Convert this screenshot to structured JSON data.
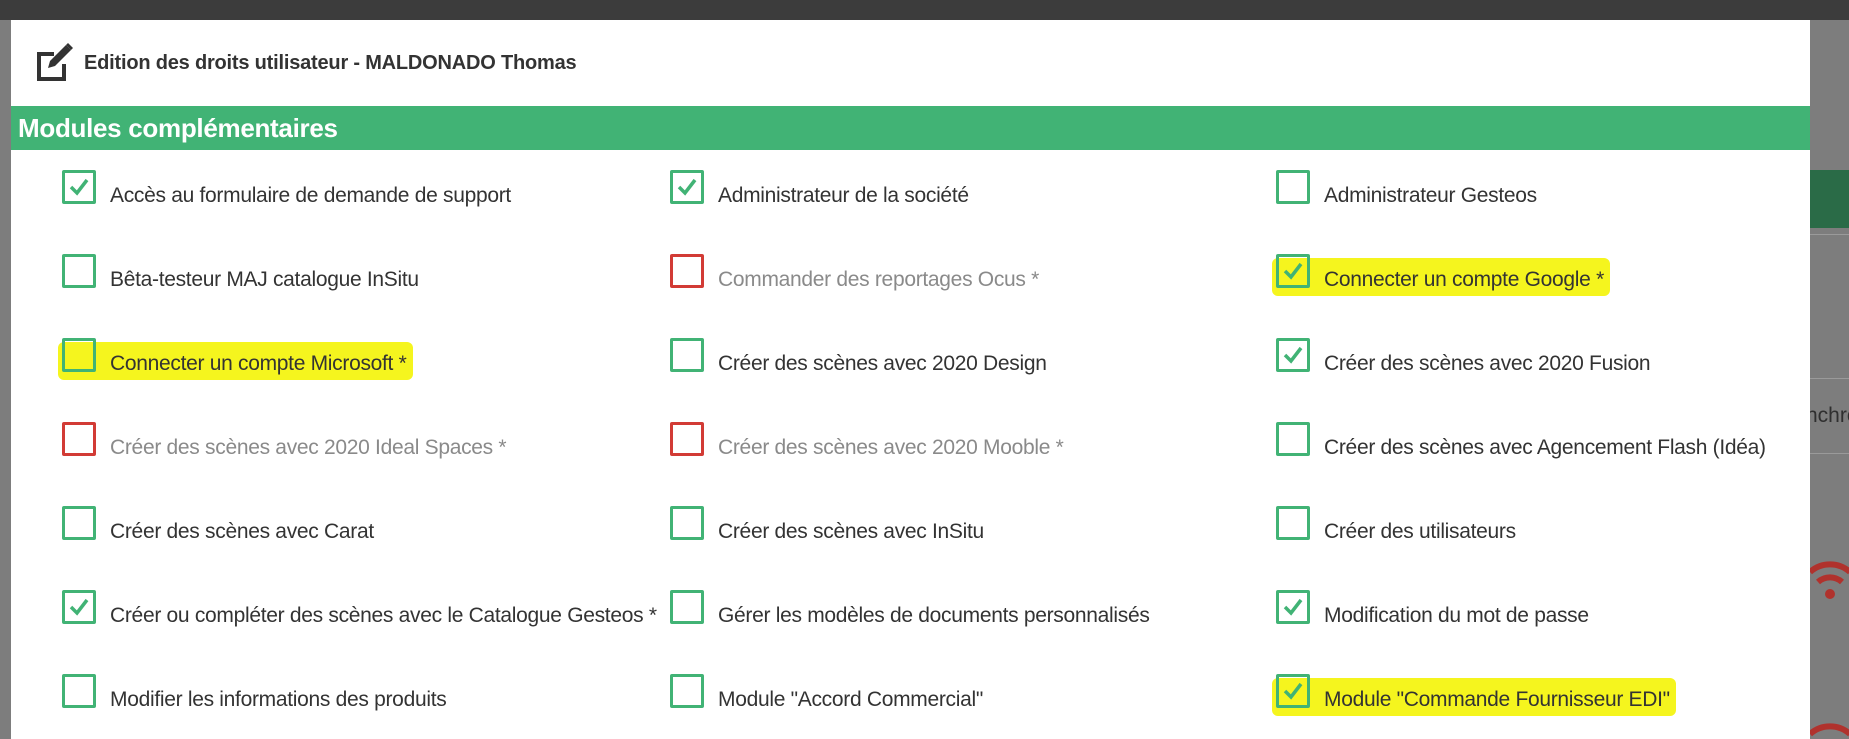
{
  "modal": {
    "title": "Edition des droits utilisateur - MALDONADO Thomas",
    "section_title": "Modules complémentaires"
  },
  "background": {
    "partial_text": "nchro"
  },
  "colors": {
    "accent_green": "#41b375",
    "disabled_red": "#d23b35",
    "highlight_yellow": "#f5f51e"
  },
  "rights": [
    [
      {
        "label": "Accès au formulaire de demande de support",
        "checked": true,
        "disabled": false,
        "highlighted": false
      },
      {
        "label": "Administrateur de la société",
        "checked": true,
        "disabled": false,
        "highlighted": false
      },
      {
        "label": "Administrateur Gesteos",
        "checked": false,
        "disabled": false,
        "highlighted": false
      }
    ],
    [
      {
        "label": "Bêta-testeur MAJ catalogue InSitu",
        "checked": false,
        "disabled": false,
        "highlighted": false
      },
      {
        "label": "Commander des reportages Ocus *",
        "checked": false,
        "disabled": true,
        "highlighted": false
      },
      {
        "label": "Connecter un compte Google *",
        "checked": true,
        "disabled": false,
        "highlighted": true
      }
    ],
    [
      {
        "label": "Connecter un compte Microsoft *",
        "checked": false,
        "disabled": false,
        "highlighted": true
      },
      {
        "label": "Créer des scènes avec 2020 Design",
        "checked": false,
        "disabled": false,
        "highlighted": false
      },
      {
        "label": "Créer des scènes avec 2020 Fusion",
        "checked": true,
        "disabled": false,
        "highlighted": false
      }
    ],
    [
      {
        "label": "Créer des scènes avec 2020 Ideal Spaces *",
        "checked": false,
        "disabled": true,
        "highlighted": false
      },
      {
        "label": "Créer des scènes avec 2020 Mooble *",
        "checked": false,
        "disabled": true,
        "highlighted": false
      },
      {
        "label": "Créer des scènes avec Agencement Flash (Idéa)",
        "checked": false,
        "disabled": false,
        "highlighted": false
      }
    ],
    [
      {
        "label": "Créer des scènes avec Carat",
        "checked": false,
        "disabled": false,
        "highlighted": false
      },
      {
        "label": "Créer des scènes avec InSitu",
        "checked": false,
        "disabled": false,
        "highlighted": false
      },
      {
        "label": "Créer des utilisateurs",
        "checked": false,
        "disabled": false,
        "highlighted": false
      }
    ],
    [
      {
        "label": "Créer ou compléter des scènes avec le Catalogue Gesteos *",
        "checked": true,
        "disabled": false,
        "highlighted": false
      },
      {
        "label": "Gérer les modèles de documents personnalisés",
        "checked": false,
        "disabled": false,
        "highlighted": false
      },
      {
        "label": "Modification du mot de passe",
        "checked": true,
        "disabled": false,
        "highlighted": false
      }
    ],
    [
      {
        "label": "Modifier les informations des produits",
        "checked": false,
        "disabled": false,
        "highlighted": false
      },
      {
        "label": "Module \"Accord Commercial\"",
        "checked": false,
        "disabled": false,
        "highlighted": false
      },
      {
        "label": "Module \"Commande Fournisseur EDI\"",
        "checked": true,
        "disabled": false,
        "highlighted": true
      }
    ]
  ]
}
